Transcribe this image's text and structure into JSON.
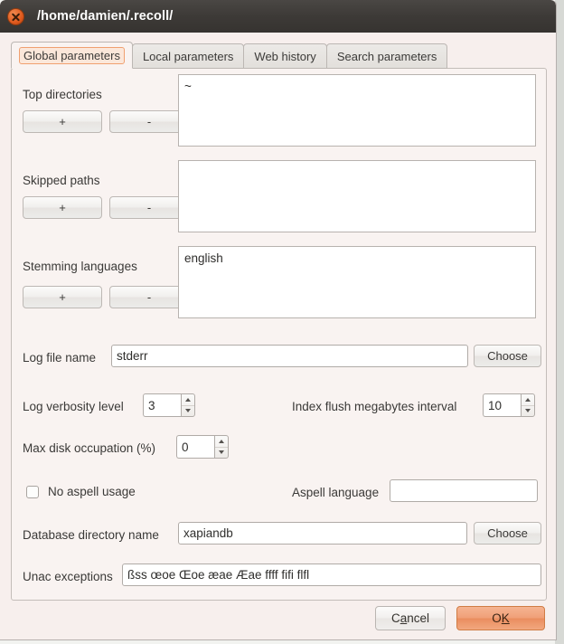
{
  "window": {
    "title": "/home/damien/.recoll/",
    "close_icon": "close-icon"
  },
  "tabs": [
    {
      "label": "Global parameters",
      "active": true
    },
    {
      "label": "Local parameters",
      "active": false
    },
    {
      "label": "Web history",
      "active": false
    },
    {
      "label": "Search parameters",
      "active": false
    }
  ],
  "form": {
    "top_directories": {
      "label": "Top directories",
      "add_label": "+",
      "remove_label": "-",
      "items": [
        "~"
      ]
    },
    "skipped_paths": {
      "label": "Skipped paths",
      "add_label": "+",
      "remove_label": "-",
      "items": []
    },
    "stemming_languages": {
      "label": "Stemming languages",
      "add_label": "+",
      "remove_label": "-",
      "items": [
        "english"
      ]
    },
    "log_file_name": {
      "label": "Log file name",
      "value": "stderr",
      "choose_label": "Choose"
    },
    "log_verbosity_level": {
      "label": "Log verbosity level",
      "value": "3"
    },
    "index_flush_megabytes_interval": {
      "label": "Index flush megabytes interval",
      "value": "10"
    },
    "max_disk_occupation": {
      "label": "Max disk occupation (%)",
      "value": "0"
    },
    "no_aspell_usage": {
      "label": "No aspell usage",
      "checked": false
    },
    "aspell_language": {
      "label": "Aspell language",
      "value": ""
    },
    "database_directory_name": {
      "label": "Database directory name",
      "value": "xapiandb",
      "choose_label": "Choose"
    },
    "unac_exceptions": {
      "label": "Unac exceptions",
      "value": "ßss œoe Œoe æae Æae ffff fifi flfl"
    }
  },
  "buttons": {
    "cancel": {
      "prefix": "C",
      "accel": "a",
      "suffix": "ncel"
    },
    "ok": {
      "prefix": "O",
      "accel": "K",
      "suffix": ""
    }
  },
  "colors": {
    "accent": "#ef9a6e",
    "titlebar": "#3d3a37",
    "panel": "#f9f3f1"
  }
}
